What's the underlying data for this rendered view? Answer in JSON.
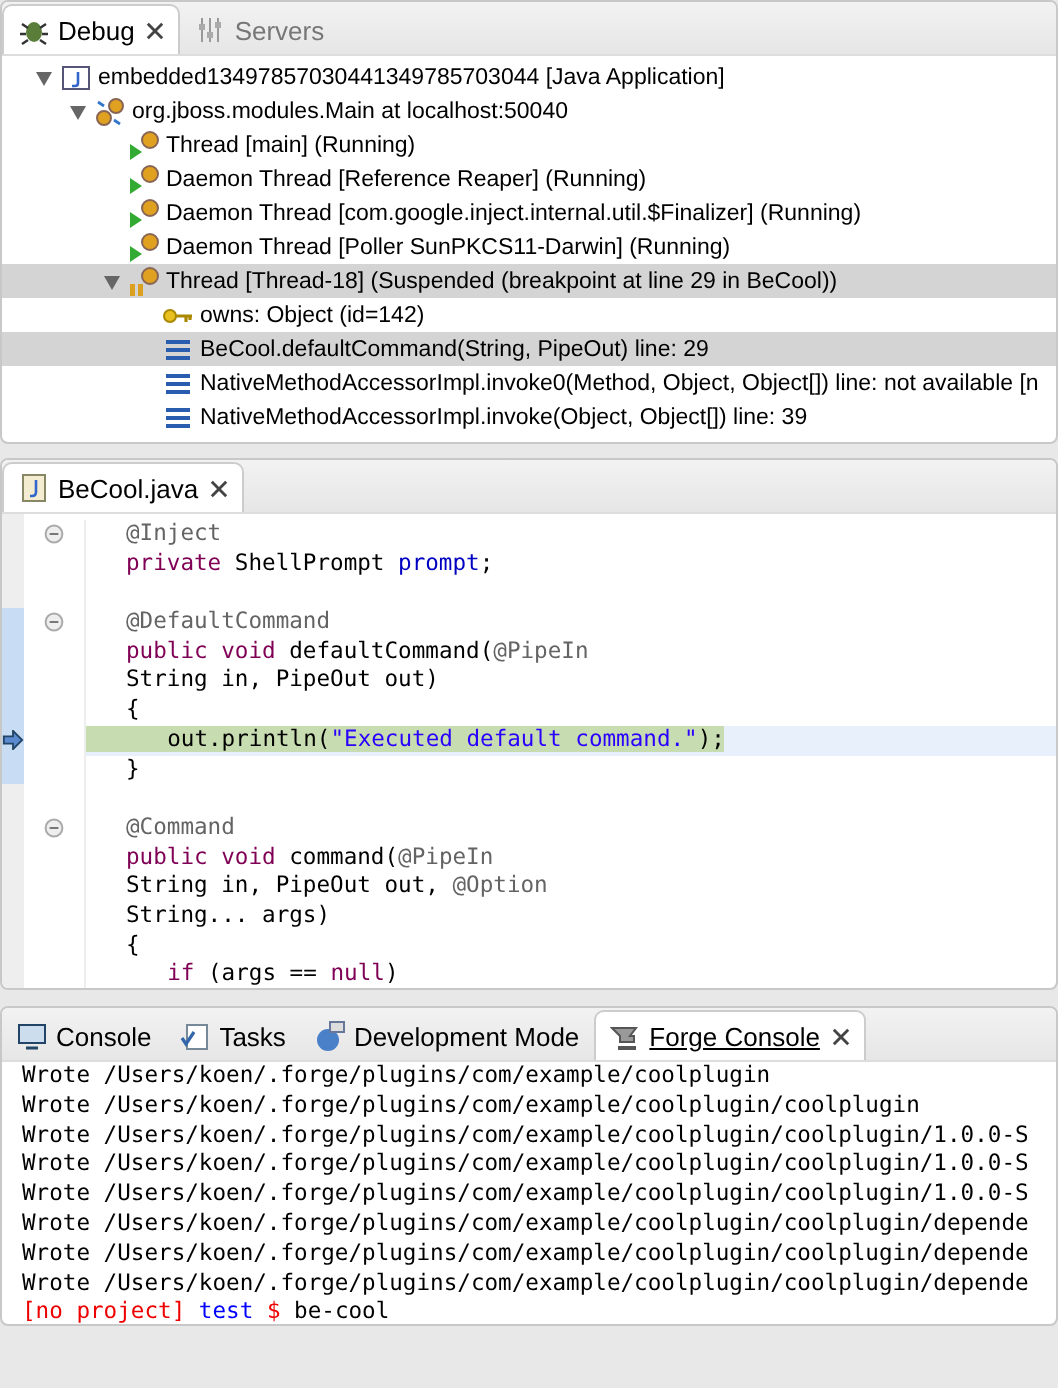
{
  "debug_view": {
    "tabs": [
      {
        "label": "Debug",
        "selected": true,
        "closable": true
      },
      {
        "label": "Servers",
        "selected": false,
        "closable": false
      }
    ],
    "tree": [
      {
        "label": "embedded13497857030441349785703044 [Java Application]",
        "kind": "java-app",
        "expanded": true,
        "selected": false,
        "children": [
          {
            "label": "org.jboss.modules.Main at localhost:50040",
            "kind": "vm",
            "expanded": true,
            "selected": false,
            "children": [
              {
                "label": "Thread [main] (Running)",
                "kind": "thread-running",
                "selected": false
              },
              {
                "label": "Daemon Thread [Reference Reaper] (Running)",
                "kind": "thread-running",
                "selected": false
              },
              {
                "label": "Daemon Thread [com.google.inject.internal.util.$Finalizer] (Running)",
                "kind": "thread-running",
                "selected": false
              },
              {
                "label": "Daemon Thread [Poller SunPKCS11-Darwin] (Running)",
                "kind": "thread-running",
                "selected": false
              },
              {
                "label": "Thread [Thread-18] (Suspended (breakpoint at line 29 in BeCool))",
                "kind": "thread-suspended",
                "expanded": true,
                "selected": true,
                "children": [
                  {
                    "label": "owns: Object  (id=142)",
                    "kind": "monitor",
                    "selected": false
                  },
                  {
                    "label": "BeCool.defaultCommand(String, PipeOut) line: 29",
                    "kind": "frame",
                    "selected": true
                  },
                  {
                    "label": "NativeMethodAccessorImpl.invoke0(Method, Object, Object[]) line: not available [n",
                    "kind": "frame",
                    "selected": false
                  },
                  {
                    "label": "NativeMethodAccessorImpl.invoke(Object, Object[]) line: 39",
                    "kind": "frame",
                    "selected": false
                  }
                ]
              }
            ]
          }
        ]
      }
    ]
  },
  "editor": {
    "tab": {
      "label": "BeCool.java",
      "selected": true
    },
    "lines": [
      {
        "foldable": true,
        "marked": false,
        "current": false,
        "indented": false,
        "segments": [
          {
            "kind": "annotation",
            "text": "@Inject"
          }
        ]
      },
      {
        "foldable": false,
        "marked": false,
        "current": false,
        "indented": false,
        "segments": [
          {
            "kind": "keyword",
            "text": "private"
          },
          {
            "kind": "plain",
            "text": " ShellPrompt "
          },
          {
            "kind": "field",
            "text": "prompt"
          },
          {
            "kind": "plain",
            "text": ";"
          }
        ]
      },
      {
        "foldable": false,
        "marked": false,
        "current": false
      },
      {
        "foldable": true,
        "marked": true,
        "current": false,
        "indented": false,
        "segments": [
          {
            "kind": "annotation",
            "text": "@DefaultCommand"
          }
        ]
      },
      {
        "foldable": false,
        "marked": true,
        "current": false,
        "indented": false,
        "segments": [
          {
            "kind": "keyword",
            "text": "public void"
          },
          {
            "kind": "plain",
            "text": " defaultCommand("
          },
          {
            "kind": "annotation",
            "text": "@PipeIn"
          }
        ]
      },
      {
        "foldable": false,
        "marked": true,
        "current": false,
        "indented": false,
        "segments": [
          {
            "kind": "plain",
            "text": "String in, PipeOut out)"
          }
        ]
      },
      {
        "foldable": false,
        "marked": true,
        "current": false,
        "indented": false,
        "segments": [
          {
            "kind": "plain",
            "text": "{"
          }
        ]
      },
      {
        "foldable": false,
        "marked": true,
        "current": true,
        "indented": true,
        "segments": [
          {
            "kind": "plain",
            "text": "out.println("
          },
          {
            "kind": "string",
            "text": "\"Executed default command.\""
          },
          {
            "kind": "plain",
            "text": ");"
          }
        ]
      },
      {
        "foldable": false,
        "marked": true,
        "current": false,
        "indented": false,
        "segments": [
          {
            "kind": "plain",
            "text": "}"
          }
        ]
      },
      {
        "foldable": false,
        "marked": false,
        "current": false
      },
      {
        "foldable": true,
        "marked": false,
        "current": false,
        "indented": false,
        "segments": [
          {
            "kind": "annotation",
            "text": "@Command"
          }
        ]
      },
      {
        "foldable": false,
        "marked": false,
        "current": false,
        "indented": false,
        "segments": [
          {
            "kind": "keyword",
            "text": "public void"
          },
          {
            "kind": "plain",
            "text": " command("
          },
          {
            "kind": "annotation",
            "text": "@PipeIn"
          }
        ]
      },
      {
        "foldable": false,
        "marked": false,
        "current": false,
        "indented": false,
        "segments": [
          {
            "kind": "plain",
            "text": "String in, PipeOut out, "
          },
          {
            "kind": "annotation",
            "text": "@Option"
          }
        ]
      },
      {
        "foldable": false,
        "marked": false,
        "current": false,
        "indented": false,
        "segments": [
          {
            "kind": "plain",
            "text": "String... args)"
          }
        ]
      },
      {
        "foldable": false,
        "marked": false,
        "current": false,
        "indented": false,
        "segments": [
          {
            "kind": "plain",
            "text": "{"
          }
        ]
      },
      {
        "foldable": false,
        "marked": false,
        "current": false,
        "indented": true,
        "segments": [
          {
            "kind": "keyword",
            "text": "if"
          },
          {
            "kind": "plain",
            "text": " (args == "
          },
          {
            "kind": "keyword",
            "text": "null"
          },
          {
            "kind": "plain",
            "text": ")"
          }
        ]
      }
    ]
  },
  "console_view": {
    "tabs": [
      {
        "label": "Console",
        "selected": false,
        "closable": false
      },
      {
        "label": "Tasks",
        "selected": false,
        "closable": false
      },
      {
        "label": "Development Mode",
        "selected": false,
        "closable": false
      },
      {
        "label": "Forge Console",
        "selected": true,
        "closable": true
      }
    ],
    "output": [
      "Wrote /Users/koen/.forge/plugins/com/example/coolplugin",
      "Wrote /Users/koen/.forge/plugins/com/example/coolplugin/coolplugin",
      "Wrote /Users/koen/.forge/plugins/com/example/coolplugin/coolplugin/1.0.0-S",
      "Wrote /Users/koen/.forge/plugins/com/example/coolplugin/coolplugin/1.0.0-S",
      "Wrote /Users/koen/.forge/plugins/com/example/coolplugin/coolplugin/1.0.0-S",
      "Wrote /Users/koen/.forge/plugins/com/example/coolplugin/coolplugin/depende",
      "Wrote /Users/koen/.forge/plugins/com/example/coolplugin/coolplugin/depende",
      "Wrote /Users/koen/.forge/plugins/com/example/coolplugin/coolplugin/depende"
    ],
    "prompt": [
      {
        "kind": "project",
        "text": "[no project]"
      },
      {
        "kind": "path",
        "text": "test"
      },
      {
        "kind": "symbol",
        "text": "$"
      },
      {
        "kind": "command",
        "text": "be-cool"
      }
    ]
  }
}
